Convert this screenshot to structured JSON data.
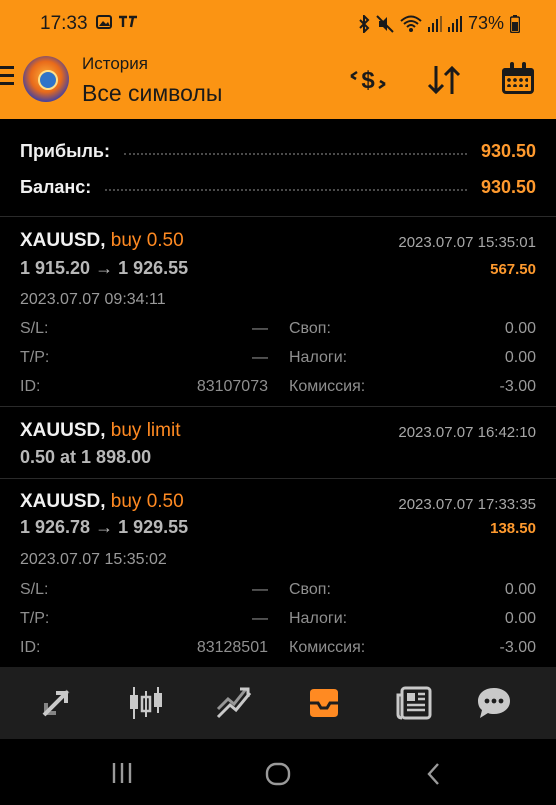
{
  "status_bar": {
    "time": "17:33",
    "battery": "73%",
    "left_icons": [
      "gallery-icon",
      "telegram-icon"
    ],
    "right_icons": [
      "bluetooth-icon",
      "mute-icon",
      "wifi-icon",
      "signal-icon",
      "signal-icon",
      "battery-icon"
    ]
  },
  "header": {
    "subtitle": "История",
    "title": "Все символы",
    "accent_color": "#fb9413",
    "actions": [
      "currency-icon",
      "sort-icon",
      "calendar-icon"
    ]
  },
  "summary": {
    "profit_label": "Прибыль:",
    "profit_value": "930.50",
    "balance_label": "Баланс:",
    "balance_value": "930.50"
  },
  "trades": [
    {
      "symbol": "XAUUSD,",
      "direction": "buy 0.50",
      "time": "2023.07.07 15:35:01",
      "prices": "1 915.20 → 1 926.55",
      "profit": "567.50",
      "open_time": "2023.07.07 09:34:11",
      "sl_label": "S/L:",
      "sl_value": "—",
      "tp_label": "T/P:",
      "tp_value": "—",
      "id_label": "ID:",
      "id_value": "83107073",
      "swap_label": "Своп:",
      "swap_value": "0.00",
      "taxes_label": "Налоги:",
      "taxes_value": "0.00",
      "commission_label": "Комиссия:",
      "commission_value": "-3.00"
    },
    {
      "symbol": "XAUUSD,",
      "direction": "buy limit",
      "time": "2023.07.07 16:42:10",
      "prices": "0.50 at 1 898.00"
    },
    {
      "symbol": "XAUUSD,",
      "direction": "buy 0.50",
      "time": "2023.07.07 17:33:35",
      "prices": "1 926.78 → 1 929.55",
      "profit": "138.50",
      "open_time": "2023.07.07 15:35:02",
      "sl_label": "S/L:",
      "sl_value": "—",
      "tp_label": "T/P:",
      "tp_value": "—",
      "id_label": "ID:",
      "id_value": "83128501",
      "swap_label": "Своп:",
      "swap_value": "0.00",
      "taxes_label": "Налоги:",
      "taxes_value": "0.00",
      "commission_label": "Комиссия:",
      "commission_value": "-3.00"
    }
  ],
  "bottom_nav": {
    "items": [
      "quotes-icon",
      "chart-icon",
      "trade-icon",
      "history-icon",
      "news-icon",
      "messages-icon"
    ],
    "active": "history-icon"
  },
  "system_nav": [
    "recents-icon",
    "home-icon",
    "back-icon"
  ]
}
